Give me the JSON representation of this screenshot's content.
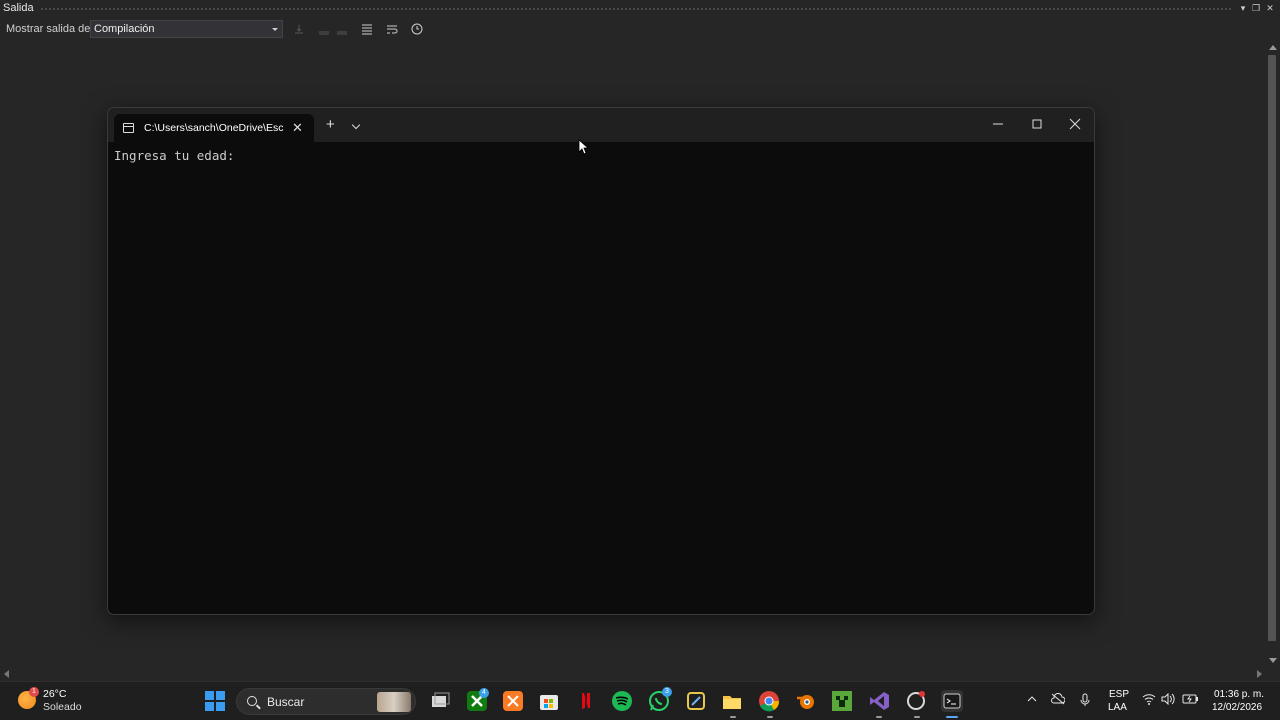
{
  "panel": {
    "title": "Salida",
    "show_output_label": "Mostrar salida de:",
    "source_selected": "Compilación"
  },
  "terminal": {
    "tab_title": "C:\\Users\\sanch\\OneDrive\\Escr",
    "new_tab_label": "+",
    "output_line": "Ingresa tu edad:"
  },
  "taskbar": {
    "weather_temp": "26°C",
    "weather_condition": "Soleado",
    "weather_badge": "1",
    "search_placeholder": "Buscar",
    "xbox_badge": "4",
    "whatsapp_badge": "3",
    "language_top": "ESP",
    "language_bottom": "LAA",
    "time": "01:36 p. m.",
    "date": "12/02/2026",
    "apps": [
      "windows-start",
      "search",
      "task-view",
      "xbox",
      "xampp",
      "microsoft-store",
      "netflix",
      "spotify",
      "whatsapp",
      "snipping-tool",
      "file-explorer",
      "chrome",
      "blender",
      "minecraft",
      "visual-studio",
      "github-desktop",
      "terminal"
    ]
  },
  "colors": {
    "terminal_bg": "#0c0c0c",
    "titlebar_bg": "#202020",
    "ide_bg": "#262626",
    "taskbar_bg": "#1f1f1f"
  }
}
